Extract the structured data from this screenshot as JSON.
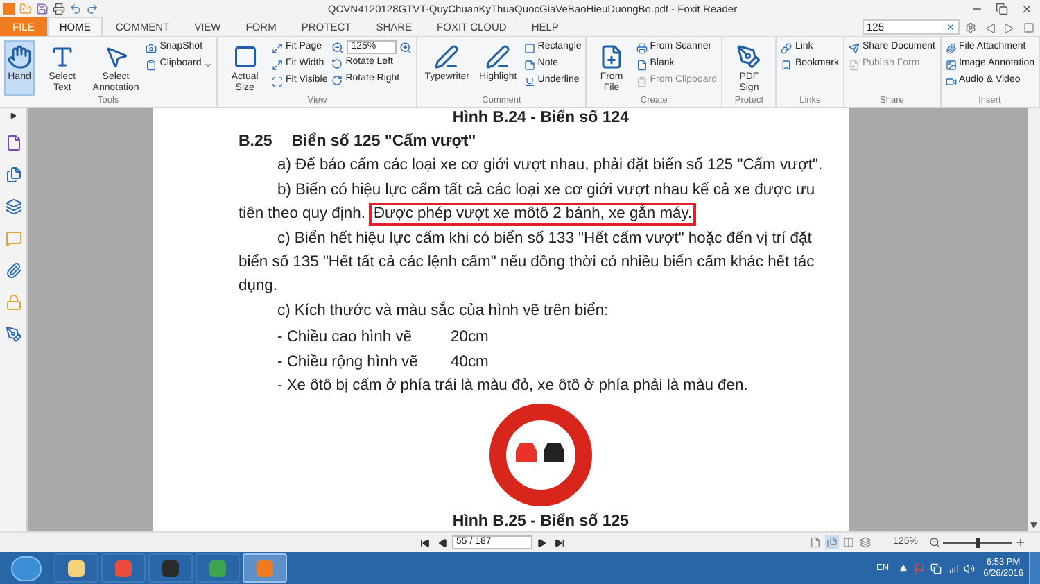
{
  "title_bar": {
    "title": "QCVN4120128GTVT-QuyChuanKyThuaQuocGiaVeBaoHieuDuongBo.pdf - Foxit Reader"
  },
  "tabs": [
    {
      "label": "FILE",
      "kind": "file",
      "selected": false
    },
    {
      "label": "HOME",
      "kind": "tab",
      "selected": true
    },
    {
      "label": "COMMENT",
      "kind": "tab",
      "selected": false
    },
    {
      "label": "VIEW",
      "kind": "tab",
      "selected": false
    },
    {
      "label": "FORM",
      "kind": "tab",
      "selected": false
    },
    {
      "label": "PROTECT",
      "kind": "tab",
      "selected": false
    },
    {
      "label": "SHARE",
      "kind": "tab",
      "selected": false
    },
    {
      "label": "FOXIT CLOUD",
      "kind": "tab",
      "selected": false
    },
    {
      "label": "HELP",
      "kind": "tab",
      "selected": false
    }
  ],
  "search": {
    "value": "125"
  },
  "ribbon": [
    {
      "label": "Tools",
      "columns": [
        {
          "kind": "large",
          "label": "Hand",
          "selected": true
        },
        {
          "kind": "large",
          "label": "Select Text",
          "selected": false
        },
        {
          "kind": "large",
          "label": "Select Annotation",
          "selected": false
        },
        {
          "kind": "stack",
          "items": [
            {
              "kind": "button",
              "label": "SnapShot",
              "disabled": false
            },
            {
              "kind": "menu",
              "label": "Clipboard",
              "disabled": false
            }
          ]
        }
      ]
    },
    {
      "label": "View",
      "columns": [
        {
          "kind": "large",
          "label": "Actual Size",
          "selected": false
        },
        {
          "kind": "stack",
          "items": [
            {
              "kind": "button",
              "label": "Fit Page",
              "disabled": false
            },
            {
              "kind": "button",
              "label": "Fit Width",
              "disabled": false
            },
            {
              "kind": "button",
              "label": "Fit Visible",
              "disabled": false
            }
          ]
        },
        {
          "kind": "stack",
          "items": [
            {
              "kind": "zoom",
              "label": "125%",
              "disabled": false
            },
            {
              "kind": "button",
              "label": "Rotate Left",
              "disabled": false
            },
            {
              "kind": "button",
              "label": "Rotate Right",
              "disabled": false
            }
          ]
        }
      ]
    },
    {
      "label": "Comment",
      "columns": [
        {
          "kind": "large",
          "label": "Typewriter",
          "selected": false
        },
        {
          "kind": "large",
          "label": "Highlight",
          "selected": false
        },
        {
          "kind": "stack",
          "items": [
            {
              "kind": "button",
              "label": "Rectangle",
              "disabled": false
            },
            {
              "kind": "button",
              "label": "Note",
              "disabled": false
            },
            {
              "kind": "button",
              "label": "Underline",
              "disabled": false
            }
          ]
        }
      ]
    },
    {
      "label": "Create",
      "columns": [
        {
          "kind": "large",
          "label": "From File",
          "selected": false
        },
        {
          "kind": "stack",
          "items": [
            {
              "kind": "button",
              "label": "From Scanner",
              "disabled": false
            },
            {
              "kind": "button",
              "label": "Blank",
              "disabled": false
            },
            {
              "kind": "button",
              "label": "From Clipboard",
              "disabled": true
            }
          ]
        }
      ]
    },
    {
      "label": "Protect",
      "columns": [
        {
          "kind": "large",
          "label": "PDF Sign",
          "selected": false
        }
      ]
    },
    {
      "label": "Links",
      "columns": [
        {
          "kind": "stack",
          "items": [
            {
              "kind": "button",
              "label": "Link",
              "disabled": false
            },
            {
              "kind": "button",
              "label": "Bookmark",
              "disabled": false
            }
          ]
        }
      ]
    },
    {
      "label": "Share",
      "columns": [
        {
          "kind": "stack",
          "items": [
            {
              "kind": "button",
              "label": "Share Document",
              "disabled": false
            },
            {
              "kind": "button",
              "label": "Publish Form",
              "disabled": true
            }
          ]
        }
      ]
    },
    {
      "label": "Insert",
      "columns": [
        {
          "kind": "stack",
          "items": [
            {
              "kind": "button",
              "label": "File Attachment",
              "disabled": false
            },
            {
              "kind": "button",
              "label": "Image Annotation",
              "disabled": false
            },
            {
              "kind": "button",
              "label": "Audio & Video",
              "disabled": false
            }
          ]
        }
      ]
    }
  ],
  "document": {
    "blocks": [
      {
        "kind": "caption",
        "text": "Hình B.24 - Biển số 124"
      },
      {
        "kind": "heading",
        "number": "B.25",
        "text": "Biển số 125 \"Cấm vượt\""
      },
      {
        "kind": "para",
        "text": "a) Để báo cấm các loại xe cơ giới vượt nhau, phải đặt biển số 125 \"Cấm vượt\"."
      },
      {
        "kind": "annotated",
        "lines": [
          "b) Biển có hiệu lực cấm tất cả các loại xe cơ giới vượt nhau kể cả xe được ưu",
          "tiên theo quy định."
        ],
        "highlight": "Được phép vượt xe môtô 2 bánh, xe gắn máy."
      },
      {
        "kind": "para",
        "text": "c) Biển hết hiệu lực cấm khi có biển số 133 \"Hết cấm vượt\" hoặc đến vị trí đặt biển số 135 \"Hết tất cả các lệnh cấm\" nếu đồng thời có nhiều biển cấm khác hết tác dụng."
      },
      {
        "kind": "para",
        "text": "c) Kích thước và màu sắc của hình vẽ trên biển:"
      },
      {
        "kind": "dim",
        "label": "- Chiều cao hình vẽ",
        "value": "20cm"
      },
      {
        "kind": "dim",
        "label": "- Chiều rộng hình vẽ",
        "value": "40cm"
      },
      {
        "kind": "para",
        "text": "- Xe ôtô bị cấm ở phía trái là màu đỏ, xe ôtô ở phía phải là màu đen."
      },
      {
        "kind": "sign"
      },
      {
        "kind": "caption",
        "text": "Hình B.25 - Biển số 125"
      }
    ]
  },
  "status_bar": {
    "page": "55 / 187",
    "zoom": "125%",
    "zoom_slider": {
      "level": 0.5
    },
    "views": [
      {
        "selected": false
      },
      {
        "selected": true
      },
      {
        "selected": false
      },
      {
        "selected": false
      }
    ]
  },
  "taskbar": {
    "apps": [
      {
        "selected": false
      },
      {
        "selected": false
      },
      {
        "selected": false
      },
      {
        "selected": false
      },
      {
        "selected": true
      }
    ],
    "language": "EN",
    "time": "6:53 PM",
    "date": "6/26/2016"
  }
}
